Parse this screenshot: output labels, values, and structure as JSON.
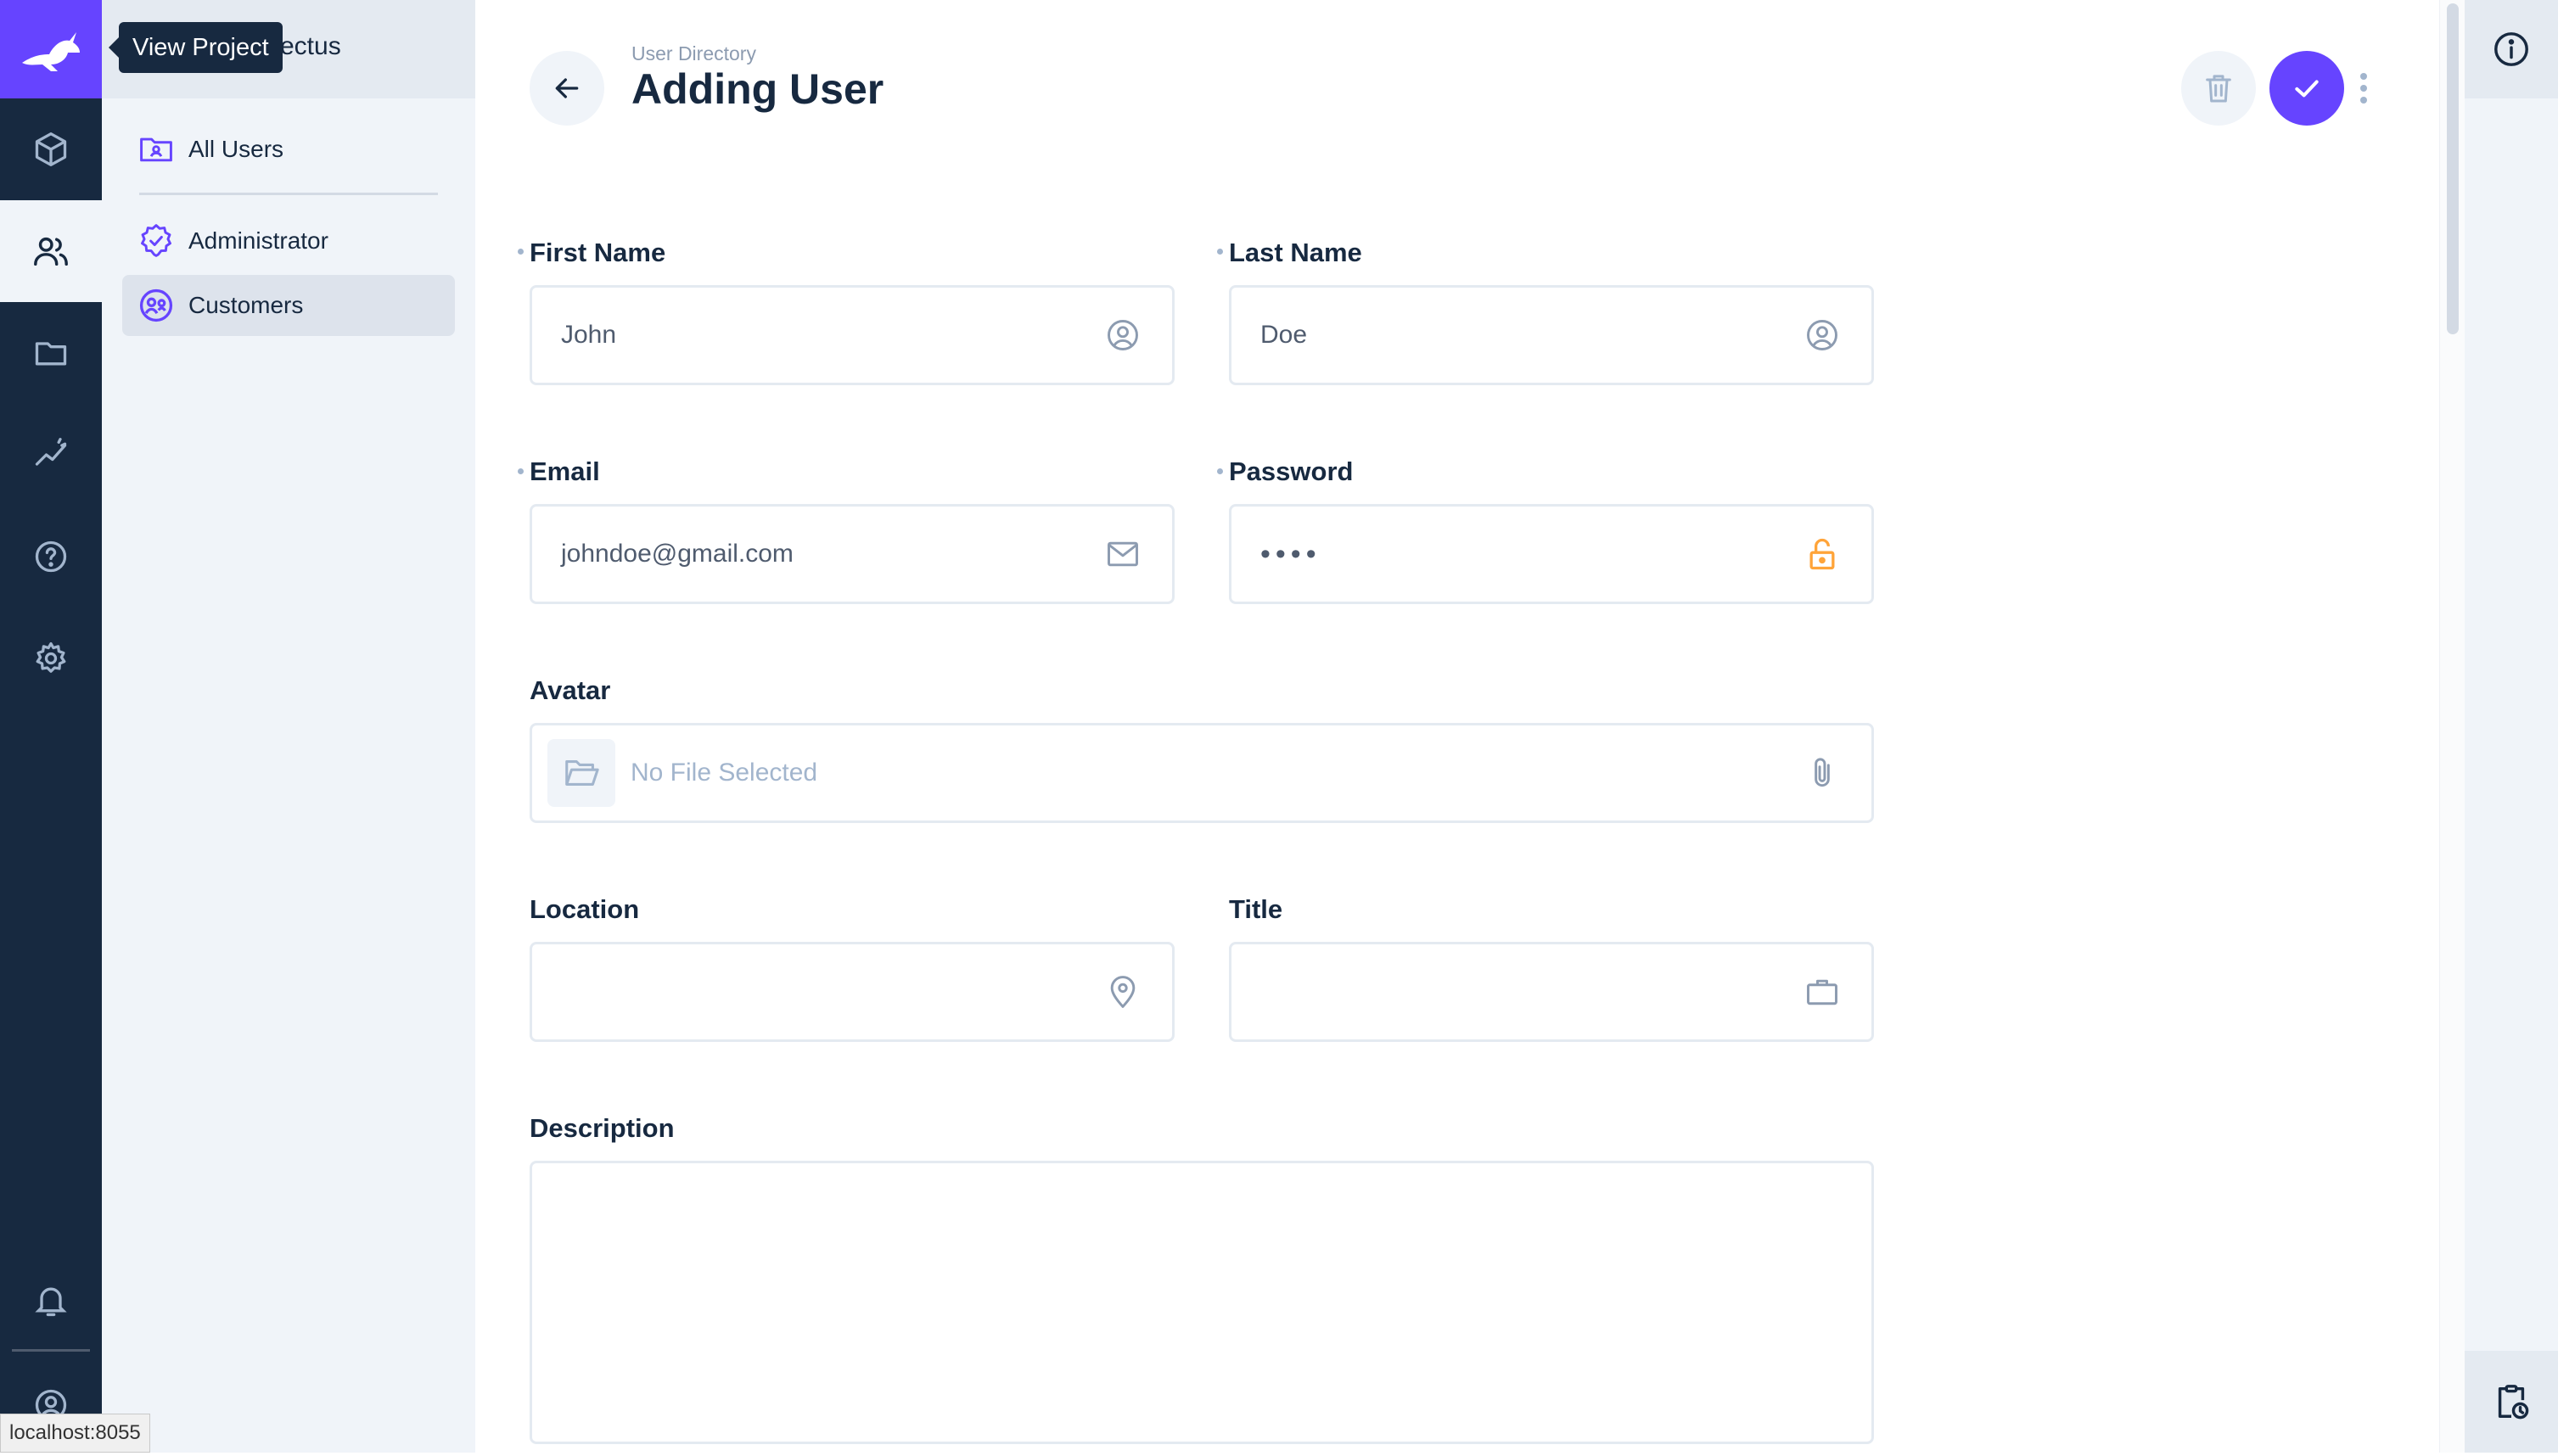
{
  "tooltip": "View Project",
  "project": {
    "name_visible": "ectus"
  },
  "nav": {
    "items": [
      {
        "label": "All Users"
      },
      {
        "label": "Administrator"
      },
      {
        "label": "Customers"
      }
    ]
  },
  "header": {
    "breadcrumb": "User Directory",
    "title": "Adding User"
  },
  "form": {
    "first_name": {
      "label": "First Name",
      "value": "John",
      "icon": "user-circle-icon"
    },
    "last_name": {
      "label": "Last Name",
      "value": "Doe",
      "icon": "user-circle-icon"
    },
    "email": {
      "label": "Email",
      "value": "johndoe@gmail.com",
      "icon": "mail-icon"
    },
    "password": {
      "label": "Password",
      "value": "••••",
      "icon": "lock-open-icon"
    },
    "avatar": {
      "label": "Avatar",
      "value": "No File Selected",
      "icon": "paperclip-icon"
    },
    "location": {
      "label": "Location",
      "value": "",
      "icon": "location-pin-icon"
    },
    "title": {
      "label": "Title",
      "value": "",
      "icon": "briefcase-icon"
    },
    "description": {
      "label": "Description",
      "value": ""
    }
  },
  "status_bar": "localhost:8055",
  "colors": {
    "accent": "#6644ff",
    "rail": "#172940",
    "warning": "#ffa439"
  }
}
